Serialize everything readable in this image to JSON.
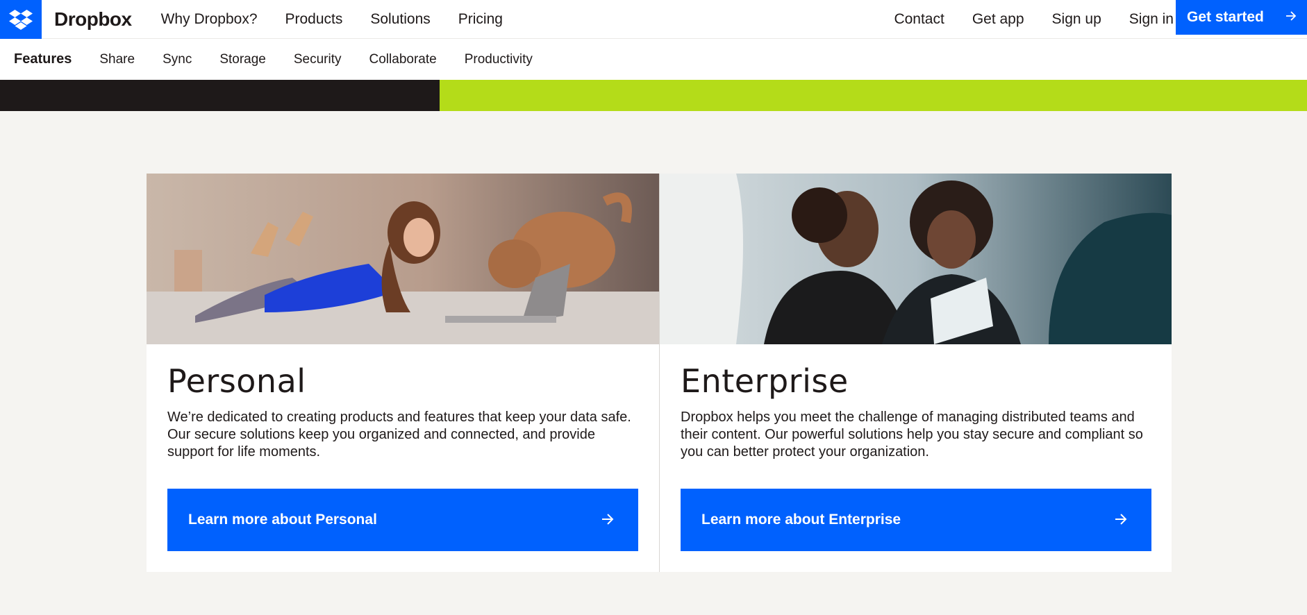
{
  "brand": {
    "name": "Dropbox",
    "logo_icon": "dropbox-logo-icon",
    "accent_color": "#0061fe"
  },
  "topnav": {
    "left_links": [
      "Why Dropbox?",
      "Products",
      "Solutions",
      "Pricing"
    ],
    "right_links": [
      "Contact",
      "Get app",
      "Sign up",
      "Sign in"
    ],
    "cta_label": "Get started",
    "cta_icon": "arrow-right-icon"
  },
  "subnav": {
    "title": "Features",
    "links": [
      "Share",
      "Sync",
      "Storage",
      "Security",
      "Collaborate",
      "Productivity"
    ]
  },
  "band_colors": {
    "dark": "#1e1919",
    "lime": "#b4dc19"
  },
  "cards": [
    {
      "title": "Personal",
      "description": "We’re dedicated to creating products and features that keep your data safe. Our secure solutions keep you organized and connected, and provide support for life moments.",
      "button_label": "Learn more about Personal",
      "button_icon": "arrow-right-icon"
    },
    {
      "title": "Enterprise",
      "description": "Dropbox helps you meet the challenge of managing distributed teams and their content. Our powerful solutions help you stay secure and compliant so you can better protect your organization.",
      "button_label": "Learn more about Enterprise",
      "button_icon": "arrow-right-icon"
    }
  ]
}
